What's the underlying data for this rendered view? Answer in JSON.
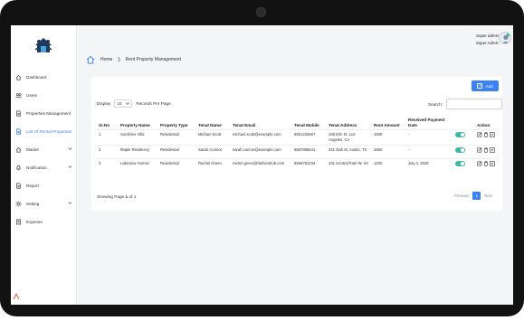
{
  "user": {
    "role": "Super admin",
    "name": "Super Admin"
  },
  "sidebar": {
    "items": [
      {
        "label": "Dashboard",
        "icon": "home-icon",
        "active": false,
        "chevron": false
      },
      {
        "label": "Users",
        "icon": "users-icon",
        "active": false,
        "chevron": false
      },
      {
        "label": "Properties Management",
        "icon": "document-icon",
        "active": false,
        "chevron": false
      },
      {
        "label": "List Of Rental Properties",
        "icon": "document-icon",
        "active": true,
        "chevron": false
      },
      {
        "label": "Master",
        "icon": "home-icon",
        "active": false,
        "chevron": true
      },
      {
        "label": "Notification",
        "icon": "bell-icon",
        "active": false,
        "chevron": true
      },
      {
        "label": "Report",
        "icon": "document-icon",
        "active": false,
        "chevron": false
      },
      {
        "label": "Setting",
        "icon": "gear-icon",
        "active": false,
        "chevron": true
      },
      {
        "label": "Expense",
        "icon": "receipt-icon",
        "active": false,
        "chevron": false
      }
    ]
  },
  "breadcrumb": {
    "home": "Home",
    "current": "Rent Property Management"
  },
  "toolbar": {
    "add_label": "Add"
  },
  "table_controls": {
    "display_label": "Display",
    "page_size": "10",
    "records_label": "Records Per Page",
    "search_label": "Search:"
  },
  "table": {
    "headers": [
      "Sr.No",
      "Property Name",
      "Property Type",
      "Tenat Name",
      "Tenat Email",
      "Tenat Mobile",
      "Tenat Address",
      "Rent Amount",
      "Received Payment Date",
      "",
      "Action"
    ],
    "rows": [
      {
        "sr": "1",
        "property": "Sunshine Villa",
        "type": "Residential",
        "tenant": "Michael Scott",
        "email": "michael.scott@example.com",
        "mobile": "5551234567",
        "address": "435 Elm St, Los Angeles, CA",
        "rent": "1500",
        "date": "-"
      },
      {
        "sr": "2",
        "property": "Maple Residency",
        "type": "Residential",
        "tenant": "Sarah Connor",
        "email": "sarah.connor@example.com",
        "mobile": "5557896541",
        "address": "321 Oak St, Austin, TX",
        "rent": "1600",
        "date": "-"
      },
      {
        "sr": "3",
        "property": "Lakeview Homes",
        "type": "Residential",
        "tenant": "Rachel Green",
        "email": "rachel.green@fashionhub.com",
        "mobile": "5556781234",
        "address": "101 Central Park W, NY",
        "rent": "1200",
        "date": "July 4, 2025"
      }
    ]
  },
  "footer": {
    "showing_prefix": "Showing Page",
    "page_current": "1",
    "of_label": "of",
    "page_total": "1",
    "previous": "Previous",
    "page_button": "1",
    "next": "Next"
  },
  "colors": {
    "accent": "#3b82f6",
    "toggle": "#3fb8a8",
    "device": "#121212"
  }
}
